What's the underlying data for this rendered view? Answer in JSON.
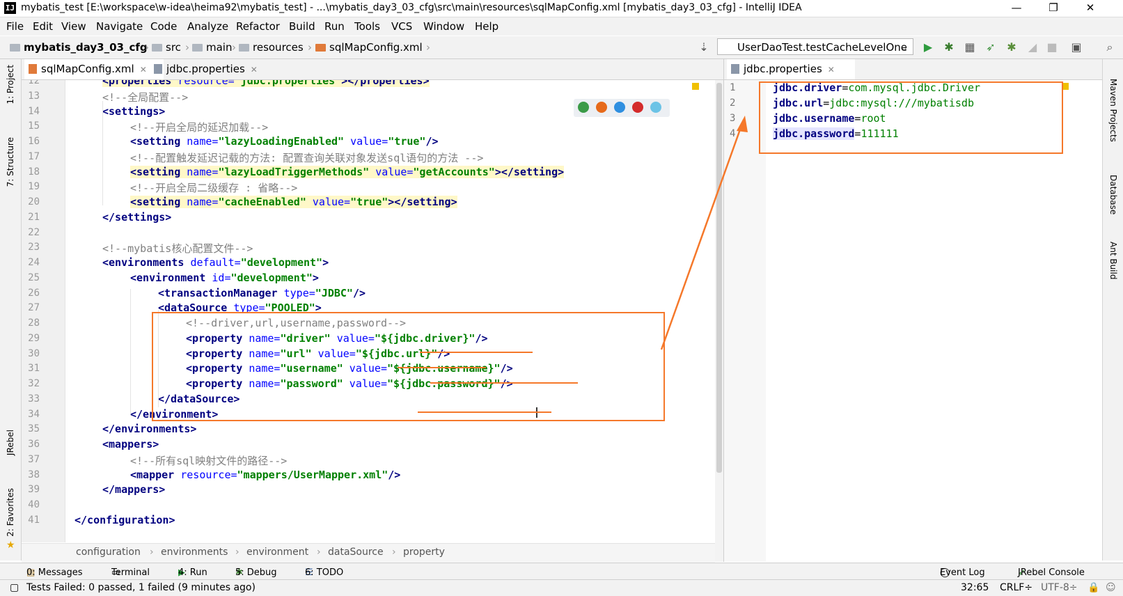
{
  "window": {
    "title": "mybatis_test [E:\\workspace\\w-idea\\heima92\\mybatis_test] - ...\\mybatis_day3_03_cfg\\src\\main\\resources\\sqlMapConfig.xml [mybatis_day3_03_cfg] - IntelliJ IDEA",
    "app_icon": "IJ",
    "minimize": "—",
    "restore": "❐",
    "close": "✕"
  },
  "menu": [
    "File",
    "Edit",
    "View",
    "Navigate",
    "Code",
    "Analyze",
    "Refactor",
    "Build",
    "Run",
    "Tools",
    "VCS",
    "Window",
    "Help"
  ],
  "breadcrumb": {
    "project": "mybatis_day3_03_cfg",
    "items": [
      "src",
      "main",
      "resources",
      "sqlMapConfig.xml"
    ]
  },
  "run_config": "UserDaoTest.testCacheLevelOne",
  "left_tools": [
    "1: Project",
    "7: Structure",
    "JRebel",
    "2: Favorites"
  ],
  "right_tools": [
    "Maven Projects",
    "Database",
    "Ant Build"
  ],
  "tabs_left": [
    {
      "label": "sqlMapConfig.xml",
      "active": true
    },
    {
      "label": "jdbc.properties",
      "active": false
    }
  ],
  "tabs_right": [
    {
      "label": "jdbc.properties",
      "active": true
    }
  ],
  "xml_lines": [
    {
      "n": "12",
      "indent": 1,
      "segs": [
        [
          "tag",
          "<properties "
        ],
        [
          "an",
          "resource="
        ],
        [
          "av",
          "\"jdbc.properties\""
        ],
        [
          "tag",
          "></properties>"
        ]
      ],
      "hl": true
    },
    {
      "n": "13",
      "indent": 1,
      "segs": [
        [
          "cm",
          "<!--全局配置-->"
        ]
      ]
    },
    {
      "n": "14",
      "indent": 1,
      "segs": [
        [
          "tag",
          "<settings>"
        ]
      ]
    },
    {
      "n": "15",
      "indent": 2,
      "segs": [
        [
          "cm",
          "<!--开启全局的延迟加载-->"
        ]
      ]
    },
    {
      "n": "16",
      "indent": 2,
      "segs": [
        [
          "tag",
          "<setting "
        ],
        [
          "an",
          "name="
        ],
        [
          "av",
          "\"lazyLoadingEnabled\""
        ],
        [
          "an",
          " value="
        ],
        [
          "av",
          "\"true\""
        ],
        [
          "tag",
          "/>"
        ]
      ]
    },
    {
      "n": "17",
      "indent": 2,
      "segs": [
        [
          "cm",
          "<!--配置触发延迟记载的方法: 配置查询关联对象发送sql语句的方法 -->"
        ]
      ]
    },
    {
      "n": "18",
      "indent": 2,
      "segs": [
        [
          "tag",
          "<setting "
        ],
        [
          "an",
          "name="
        ],
        [
          "av",
          "\"lazyLoadTriggerMethods\""
        ],
        [
          "an",
          " value="
        ],
        [
          "av",
          "\"getAccounts\""
        ],
        [
          "tag",
          "></setting>"
        ]
      ],
      "hl": true
    },
    {
      "n": "19",
      "indent": 2,
      "segs": [
        [
          "cm",
          "<!--开启全局二级缓存 : 省略-->"
        ]
      ]
    },
    {
      "n": "20",
      "indent": 2,
      "segs": [
        [
          "tag",
          "<setting "
        ],
        [
          "an",
          "name="
        ],
        [
          "av",
          "\"cacheEnabled\""
        ],
        [
          "an",
          " value="
        ],
        [
          "av",
          "\"true\""
        ],
        [
          "tag",
          "></setting>"
        ]
      ],
      "hl": true
    },
    {
      "n": "21",
      "indent": 1,
      "segs": [
        [
          "tag",
          "</settings>"
        ]
      ]
    },
    {
      "n": "22",
      "indent": 0,
      "segs": []
    },
    {
      "n": "23",
      "indent": 1,
      "segs": [
        [
          "cm",
          "<!--mybatis核心配置文件-->"
        ]
      ]
    },
    {
      "n": "24",
      "indent": 1,
      "segs": [
        [
          "tag",
          "<environments "
        ],
        [
          "an",
          "default="
        ],
        [
          "av",
          "\"development\""
        ],
        [
          "tag",
          ">"
        ]
      ]
    },
    {
      "n": "25",
      "indent": 2,
      "segs": [
        [
          "tag",
          "<environment "
        ],
        [
          "an",
          "id="
        ],
        [
          "av",
          "\"development\""
        ],
        [
          "tag",
          ">"
        ]
      ]
    },
    {
      "n": "26",
      "indent": 3,
      "segs": [
        [
          "tag",
          "<transactionManager "
        ],
        [
          "an",
          "type="
        ],
        [
          "av",
          "\"JDBC\""
        ],
        [
          "tag",
          "/>"
        ]
      ]
    },
    {
      "n": "27",
      "indent": 3,
      "segs": [
        [
          "tag",
          "<dataSource "
        ],
        [
          "an",
          "type="
        ],
        [
          "av",
          "\"POOLED\""
        ],
        [
          "tag",
          ">"
        ]
      ]
    },
    {
      "n": "28",
      "indent": 4,
      "segs": [
        [
          "cm",
          "<!--driver,url,username,password-->"
        ]
      ]
    },
    {
      "n": "29",
      "indent": 4,
      "segs": [
        [
          "tag",
          "<property "
        ],
        [
          "an",
          "name="
        ],
        [
          "av",
          "\"driver\""
        ],
        [
          "an",
          " value="
        ],
        [
          "av",
          "\"${jdbc.driver}\""
        ],
        [
          "tag",
          "/>"
        ]
      ]
    },
    {
      "n": "30",
      "indent": 4,
      "segs": [
        [
          "tag",
          "<property "
        ],
        [
          "an",
          "name="
        ],
        [
          "av",
          "\"url\""
        ],
        [
          "an",
          " value="
        ],
        [
          "av",
          "\"${jdbc.url}\""
        ],
        [
          "tag",
          "/>"
        ]
      ]
    },
    {
      "n": "31",
      "indent": 4,
      "segs": [
        [
          "tag",
          "<property "
        ],
        [
          "an",
          "name="
        ],
        [
          "av",
          "\"username\""
        ],
        [
          "an",
          " value="
        ],
        [
          "av",
          "\"${jdbc.username}\""
        ],
        [
          "tag",
          "/>"
        ]
      ]
    },
    {
      "n": "32",
      "indent": 4,
      "segs": [
        [
          "tag",
          "<property "
        ],
        [
          "an",
          "name="
        ],
        [
          "av",
          "\"password\""
        ],
        [
          "an",
          " value="
        ],
        [
          "av",
          "\"${jdbc.password}\""
        ],
        [
          "tag",
          "/>"
        ]
      ]
    },
    {
      "n": "33",
      "indent": 3,
      "segs": [
        [
          "tag",
          "</dataSource>"
        ]
      ]
    },
    {
      "n": "34",
      "indent": 2,
      "segs": [
        [
          "tag",
          "</environment>"
        ]
      ]
    },
    {
      "n": "35",
      "indent": 1,
      "segs": [
        [
          "tag",
          "</environments>"
        ]
      ]
    },
    {
      "n": "36",
      "indent": 1,
      "segs": [
        [
          "tag",
          "<mappers>"
        ]
      ]
    },
    {
      "n": "37",
      "indent": 2,
      "segs": [
        [
          "cm",
          "<!--所有sql映射文件的路径-->"
        ]
      ]
    },
    {
      "n": "38",
      "indent": 2,
      "segs": [
        [
          "tag",
          "<mapper "
        ],
        [
          "an",
          "resource="
        ],
        [
          "av",
          "\"mappers/UserMapper.xml\""
        ],
        [
          "tag",
          "/>"
        ]
      ]
    },
    {
      "n": "39",
      "indent": 1,
      "segs": [
        [
          "tag",
          "</mappers>"
        ]
      ]
    },
    {
      "n": "40",
      "indent": 0,
      "segs": []
    },
    {
      "n": "41",
      "indent": 0,
      "segs": [
        [
          "tag",
          "</configuration>"
        ]
      ]
    }
  ],
  "editor_breadcrumb": [
    "configuration",
    "environments",
    "environment",
    "dataSource",
    "property"
  ],
  "properties": [
    {
      "n": "1",
      "key": "jdbc.driver",
      "value": "com.mysql.jdbc.Driver"
    },
    {
      "n": "2",
      "key": "jdbc.url",
      "value": "jdbc:mysql:///mybatisdb"
    },
    {
      "n": "3",
      "key": "jdbc.username",
      "value": "root"
    },
    {
      "n": "4",
      "key": "jdbc.password",
      "value": "111111"
    }
  ],
  "tool_windows": [
    {
      "label": "0: Messages",
      "icon": "messages-icon"
    },
    {
      "label": "Terminal",
      "icon": "terminal-icon"
    },
    {
      "label": "4: Run",
      "icon": "run-icon"
    },
    {
      "label": "5: Debug",
      "icon": "debug-icon"
    },
    {
      "label": "6: TODO",
      "icon": "todo-icon"
    }
  ],
  "event_log": "Event Log",
  "jrebel_console": "JRebel Console",
  "status": {
    "message": "Tests Failed: 0 passed, 1 failed (9 minutes ago)",
    "position": "32:65",
    "line_sep": "CRLF÷",
    "encoding": "UTF-8÷"
  },
  "colors": {
    "annotation": "#f5782a",
    "tag": "#000080",
    "attr_value": "#008000",
    "comment": "#808080"
  }
}
